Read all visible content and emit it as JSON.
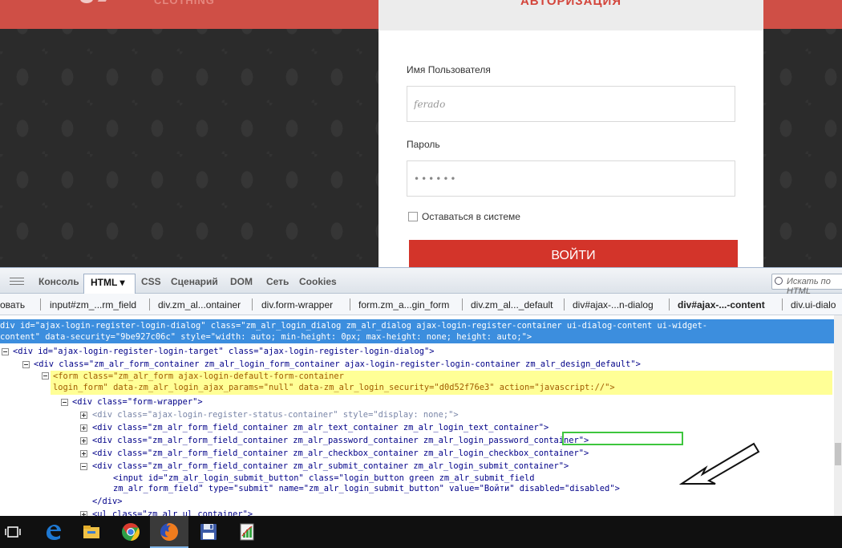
{
  "site": {
    "brand": "CLOTHING",
    "login": {
      "title": "АВТОРИЗАЦИЯ",
      "username_label": "Имя Пользователя",
      "username_value": "ferado",
      "password_label": "Пароль",
      "password_value": "••••••",
      "remember_label": "Оставаться в системе",
      "submit_label": "ВОЙТИ"
    }
  },
  "devtools": {
    "tabs": [
      "Консоль",
      "HTML",
      "CSS",
      "Сценарий",
      "DOM",
      "Сеть",
      "Cookies"
    ],
    "active_tab": "HTML",
    "search_placeholder": "Искать по HTML",
    "breadcrumbs": [
      "овать",
      "input#zm_...rm_field",
      "div.zm_al...ontainer",
      "div.form-wrapper",
      "form.zm_a...gin_form",
      "div.zm_al..._default",
      "div#ajax-...n-dialog",
      "div#ajax-...-content",
      "div.ui-dialo"
    ],
    "tree": [
      {
        "text": "div id=\"ajax-login-register-login-dialog\" class=\"zm_alr_login_dialog zm_alr_dialog ajax-login-register-container ui-dialog-content ui-widget-"
      },
      {
        "text": "content\" data-security=\"9be927c06c\" style=\"width: auto; min-height: 0px; max-height: none; height: auto;\">"
      },
      {
        "text": "<div id=\"ajax-login-register-login-target\" class=\"ajax-login-register-login-dialog\">"
      },
      {
        "text": "<div class=\"zm_alr_form_container zm_alr_login_form_container ajax-login-register-login-container zm_alr_design_default\">"
      },
      {
        "text": "<form class=\"zm_alr_form ajax-login-default-form-container"
      },
      {
        "text": "login_form\" data-zm_alr_login_ajax_params=\"null\" data-zm_alr_login_security=\"d0d52f76e3\" action=\"javascript://\">"
      },
      {
        "text": "<div class=\"form-wrapper\">"
      },
      {
        "text": "<div class=\"ajax-login-register-status-container\" style=\"display: none;\">"
      },
      {
        "text": "<div class=\"zm_alr_form_field_container zm_alr_text_container zm_alr_login_text_container\">"
      },
      {
        "text": "<div class=\"zm_alr_form_field_container zm_alr_password_container zm_alr_login_password_container\">"
      },
      {
        "text": "<div class=\"zm_alr_form_field_container zm_alr_checkbox_container zm_alr_login_checkbox_container\">"
      },
      {
        "text": "<div class=\"zm_alr_form_field_container zm_alr_submit_container zm_alr_login_submit_container\">"
      },
      {
        "text": "<input id=\"zm_alr_login_submit_button\" class=\"login_button green zm_alr_submit_field"
      },
      {
        "text": "zm_alr_form_field\" type=\"submit\" name=\"zm_alr_login_submit_button\" value=\"Войти\" disabled=\"disabled\">"
      },
      {
        "text": "</div>"
      },
      {
        "text": "<ul class=\"zm_alr_ul_container\">"
      }
    ]
  },
  "colors": {
    "site_accent": "#cf4f46",
    "button_red": "#d3342a",
    "selection_blue": "#3c8ede",
    "highlight_yellow": "#ffff96",
    "annotation_green": "#3ec63e"
  },
  "taskbar": {
    "icons": [
      "task-view-icon",
      "edge-icon",
      "file-explorer-icon",
      "chrome-icon",
      "firefox-icon",
      "floppy-save-icon",
      "spreadsheet-app-icon"
    ]
  }
}
